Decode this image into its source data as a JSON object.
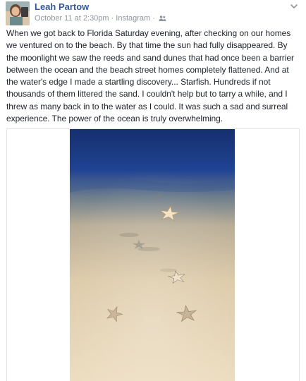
{
  "post": {
    "author": "Leah Partow",
    "date": "October 11 at 2:30pm",
    "separator": "·",
    "source": "Instagram",
    "separator2": "·",
    "audience_icon": "friends-icon",
    "menu_icon": "chevron-down-icon",
    "body": "When we got back to Florida Saturday evening, after checking on our homes we ventured on to the beach. By that time the sun had fully disappeared. By the moonlight we saw the reeds and sand dunes that had once been a barrier between the ocean and the beach street homes completely flattened. And at the water's edge I made a startling discovery... Starfish. Hundreds if not thousands of them littered the sand. I couldn't help but to tarry a while, and I threw as many back in to the water as I could. It was such a sad and surreal experience. The power of the ocean is truly overwhelming.",
    "photo_subject": "starfish-on-beach-photo"
  },
  "colors": {
    "name_link": "#365899",
    "meta": "#90949c",
    "body_text": "#1d2129",
    "ocean": "#1b3b86",
    "sand": "#e9d6b6"
  }
}
